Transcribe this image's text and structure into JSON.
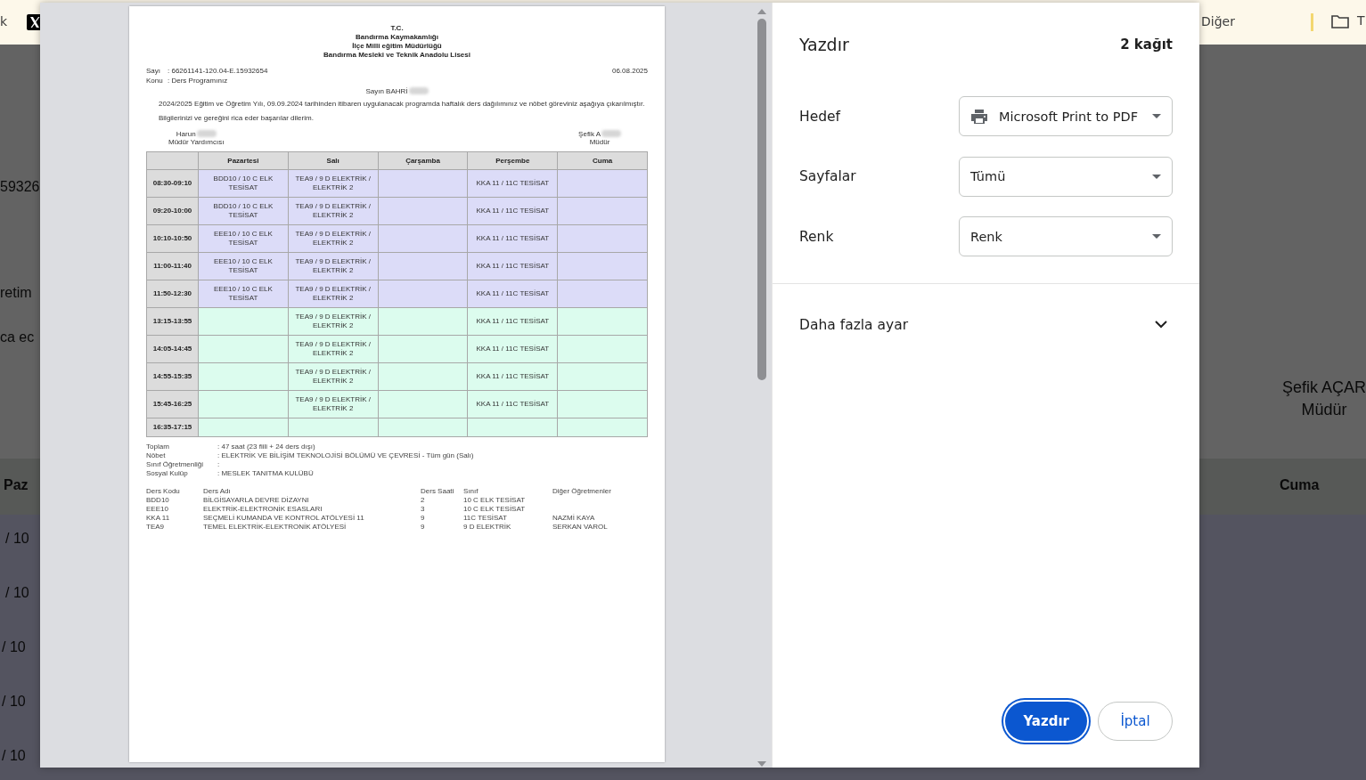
{
  "background_page": {
    "bookmarks": [
      {
        "kind": "text",
        "label": "k"
      },
      {
        "kind": "x-logo"
      },
      {
        "kind": "text",
        "label": "Diğer"
      },
      {
        "kind": "folder",
        "label": "T"
      }
    ],
    "left_snippets": [
      "59326",
      "retim",
      "ca ec"
    ],
    "signature": {
      "name": "Şefik AÇAR",
      "title": "Müdür"
    },
    "table_headers": [
      "Paz",
      "Cuma"
    ],
    "row_snippets": [
      "/ 10",
      "/ 10",
      "/ 10",
      "/ 10",
      "/ 10"
    ]
  },
  "print_preview": {
    "document": {
      "header_lines": [
        "T.C.",
        "Bandırma Kaymakamlığı",
        "İlçe Milli eğitim Müdürlüğü",
        "Bandırma Mesleki ve Teknik Anadolu Lisesi"
      ],
      "meta": [
        {
          "label": "Sayı",
          "value": ": 66261141-120.04-E.15932654"
        },
        {
          "label": "Konu",
          "value": ": Ders Programınız"
        }
      ],
      "date": "06.08.2025",
      "salutation": {
        "text": "Sayın BAHRİ",
        "redacted": true
      },
      "paragraphs": [
        "2024/2025 Eğitim ve Öğretim Yılı, 09.09.2024 tarihinden itibaren uygulanacak programda haftalık ders dağılımınız ve nöbet göreviniz aşağıya çıkarılmıştır.",
        "Bilgilerinizi ve gereğini rica eder başarılar dilerim."
      ],
      "signatures": [
        {
          "name": "Harun",
          "title": "Müdür Yardımcısı",
          "redacted": true
        },
        {
          "name": "Şefik A",
          "title": "Müdür",
          "redacted": true
        }
      ],
      "schedule": {
        "columns": [
          "Pazartesi",
          "Salı",
          "Çarşamba",
          "Perşembe",
          "Cuma"
        ],
        "rows": [
          {
            "time": "08:30-09:10",
            "color": "#dcdcf8",
            "cells": [
              "BDD10 / 10 C ELK TESİSAT",
              "TEA9 / 9 D ELEKTRİK / ELEKTRİK 2",
              null,
              "KKA 11 / 11C TESİSAT",
              null
            ]
          },
          {
            "time": "09:20-10:00",
            "color": "#dcdcf8",
            "cells": [
              "BDD10 / 10 C ELK TESİSAT",
              "TEA9 / 9 D ELEKTRİK / ELEKTRİK 2",
              null,
              "KKA 11 / 11C TESİSAT",
              null
            ]
          },
          {
            "time": "10:10-10:50",
            "color": "#dcdcf8",
            "cells": [
              "EEE10 / 10 C ELK TESİSAT",
              "TEA9 / 9 D ELEKTRİK / ELEKTRİK 2",
              null,
              "KKA 11 / 11C TESİSAT",
              null
            ]
          },
          {
            "time": "11:00-11:40",
            "color": "#dcdcf8",
            "cells": [
              "EEE10 / 10 C ELK TESİSAT",
              "TEA9 / 9 D ELEKTRİK / ELEKTRİK 2",
              null,
              "KKA 11 / 11C TESİSAT",
              null
            ]
          },
          {
            "time": "11:50-12:30",
            "color": "#dcdcf8",
            "cells": [
              "EEE10 / 10 C ELK TESİSAT",
              "TEA9 / 9 D ELEKTRİK / ELEKTRİK 2",
              null,
              "KKA 11 / 11C TESİSAT",
              null
            ]
          },
          {
            "time": "13:15-13:55",
            "color": "#dcfcee",
            "cells": [
              null,
              "TEA9 / 9 D ELEKTRİK / ELEKTRİK 2",
              null,
              "KKA 11 / 11C TESİSAT",
              null
            ]
          },
          {
            "time": "14:05-14:45",
            "color": "#dcfcee",
            "cells": [
              null,
              "TEA9 / 9 D ELEKTRİK / ELEKTRİK 2",
              null,
              "KKA 11 / 11C TESİSAT",
              null
            ]
          },
          {
            "time": "14:55-15:35",
            "color": "#dcfcee",
            "cells": [
              null,
              "TEA9 / 9 D ELEKTRİK / ELEKTRİK 2",
              null,
              "KKA 11 / 11C TESİSAT",
              null
            ]
          },
          {
            "time": "15:45-16:25",
            "color": "#dcfcee",
            "cells": [
              null,
              "TEA9 / 9 D ELEKTRİK / ELEKTRİK 2",
              null,
              "KKA 11 / 11C TESİSAT",
              null
            ]
          },
          {
            "time": "16:35-17:15",
            "color": "#dcfcee",
            "cells": [
              null,
              null,
              null,
              null,
              null
            ]
          }
        ]
      },
      "summary": [
        {
          "label": "Toplam",
          "value": ": 47 saat (23 fiili + 24 ders dışı)"
        },
        {
          "label": "Nöbet",
          "value": ": ELEKTRİK VE BİLİŞİM TEKNOLOJİSİ BÖLÜMÜ VE ÇEVRESİ - Tüm gün (Salı)"
        },
        {
          "label": "Sınıf Öğretmenliği",
          "value": ":"
        },
        {
          "label": "Sosyal Kulüp",
          "value": ": MESLEK TANITMA KULÜBÜ"
        }
      ],
      "courses": {
        "columns": [
          "Ders Kodu",
          "Ders Adı",
          "Ders Saati",
          "Sınıf",
          "Diğer Öğretmenler"
        ],
        "rows": [
          [
            "BDD10",
            "BİLGİSAYARLA DEVRE DİZAYNI",
            "2",
            "10 C ELK TESİSAT",
            null
          ],
          [
            "EEE10",
            "ELEKTRİK-ELEKTRONİK ESASLARI",
            "3",
            "10 C ELK TESİSAT",
            null
          ],
          [
            "KKA 11",
            "SEÇMELİ KUMANDA VE KONTROL ATÖLYESİ 11",
            "9",
            "11C TESİSAT",
            "NAZMİ KAYA"
          ],
          [
            "TEA9",
            "TEMEL ELEKTRİK-ELEKTRONİK ATÖLYESİ",
            "9",
            "9 D ELEKTRİK",
            "SERKAN VAROL"
          ]
        ]
      }
    }
  },
  "print_settings": {
    "title": "Yazdır",
    "sheet_count": "2 kağıt",
    "fields": [
      {
        "label": "Hedef",
        "value": "Microsoft Print to PDF",
        "kind": "printer"
      },
      {
        "label": "Sayfalar",
        "value": "Tümü",
        "kind": "plain"
      },
      {
        "label": "Renk",
        "value": "Renk",
        "kind": "plain"
      }
    ],
    "more_settings": {
      "label": "Daha fazla ayar",
      "expanded": false
    },
    "buttons": [
      {
        "label": "Yazdır",
        "kind": "primary"
      },
      {
        "label": "İptal",
        "kind": "secondary"
      }
    ]
  }
}
